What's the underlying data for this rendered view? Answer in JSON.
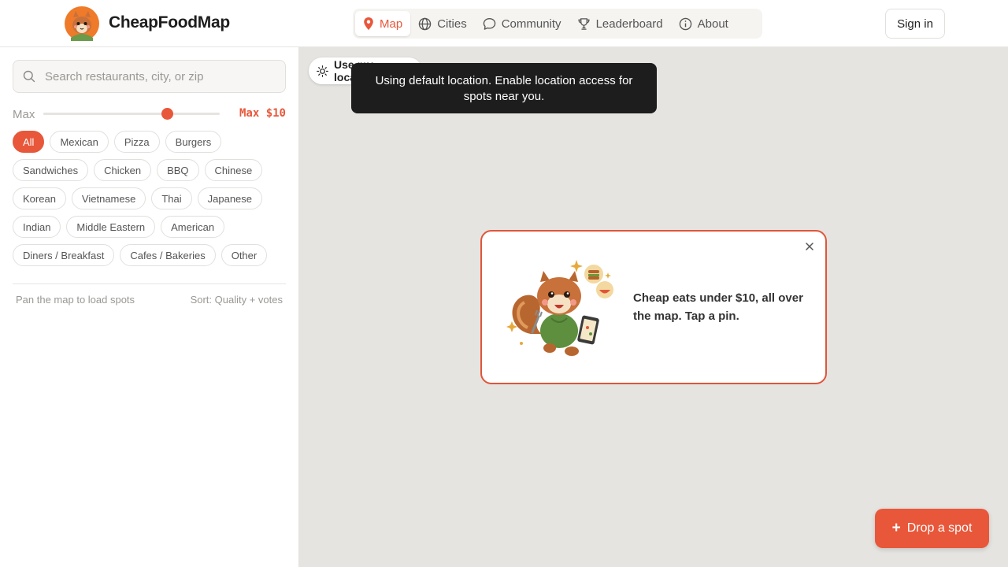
{
  "header": {
    "brand": "CheapFoodMap",
    "nav": [
      {
        "label": "Map",
        "icon": "map-pin-icon",
        "active": true
      },
      {
        "label": "Cities",
        "icon": "globe-icon"
      },
      {
        "label": "Community",
        "icon": "chat-bubble-icon"
      },
      {
        "label": "Leaderboard",
        "icon": "trophy-icon"
      },
      {
        "label": "About",
        "icon": "info-icon"
      }
    ],
    "signin_label": "Sign in"
  },
  "sidebar": {
    "search_placeholder": "Search restaurants, city, or zip",
    "price": {
      "label": "Max",
      "value_label": "Max $10",
      "slider_fraction": 0.7
    },
    "categories": [
      [
        "All",
        "Mexican",
        "Pizza",
        "Burgers"
      ],
      [
        "Sandwiches",
        "Chicken",
        "BBQ",
        "Chinese"
      ],
      [
        "Korean",
        "Vietnamese",
        "Thai",
        "Japanese"
      ],
      [
        "Indian",
        "Middle Eastern",
        "American"
      ],
      [
        "Diners / Breakfast",
        "Cafes / Bakeries",
        "Other"
      ]
    ],
    "selected_category": "All",
    "status": "Pan the map to load spots",
    "sort": "Sort: Quality + votes"
  },
  "map": {
    "use_location_label": "Use my location",
    "toast": "Using default location. Enable location access for spots near you.",
    "popup_text": "Cheap eats under $10, all over the map. Tap a pin.",
    "drop_button_label": "Drop a spot"
  },
  "colors": {
    "accent": "#e8573a",
    "map_bg": "#e5e4e0",
    "toast_bg": "#1d1d1d"
  }
}
